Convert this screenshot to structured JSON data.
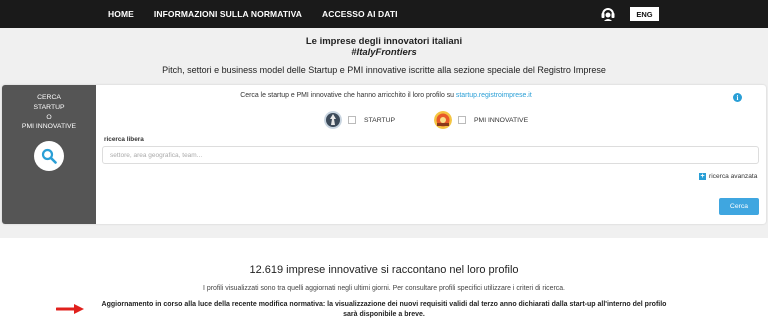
{
  "nav": {
    "items": [
      "HOME",
      "INFORMAZIONI SULLA NORMATIVA",
      "ACCESSO AI DATI"
    ],
    "lang_button": "ENG",
    "support_icon": "headset-icon"
  },
  "hero": {
    "title": "Le imprese degli innovatori italiani",
    "hashtag": "#ItalyFrontiers",
    "subtitle": "Pitch, settori e business model delle Startup e PMI innovative iscritte alla sezione speciale del Registro Imprese"
  },
  "search_panel": {
    "left_label_lines": [
      "CERCA",
      "STARTUP",
      "O",
      "PMI INNOVATIVE"
    ],
    "intro_text": "Cerca le startup e PMI innovative che hanno arricchito il loro profilo su ",
    "intro_link": "startup.registroimprese.it",
    "options": [
      {
        "label": "STARTUP",
        "checked": false
      },
      {
        "label": "PMI INNOVATIVE",
        "checked": false
      }
    ],
    "free_search_label": "ricerca libera",
    "free_search_placeholder": "settore, area geografica, team...",
    "free_search_value": "",
    "advanced_label": "ricerca avanzata",
    "search_button": "Cerca",
    "accent_color": "#2a9fd6"
  },
  "stats": {
    "title": "12.619 imprese innovative si raccontano nel loro profilo",
    "subtitle": "I profili visualizzati sono tra quelli aggiornati negli ultimi giorni. Per consultare profili specifici utilizzare i criteri di ricerca.",
    "notice_line1": "Aggiornamento in corso alla luce della recente modifica normativa: la visualizzazione dei nuovi requisiti validi dal terzo anno dichiarati dalla start-up all'interno del profilo",
    "notice_line2": "sarà disponibile a breve.",
    "arrow_color": "#e0201c"
  }
}
